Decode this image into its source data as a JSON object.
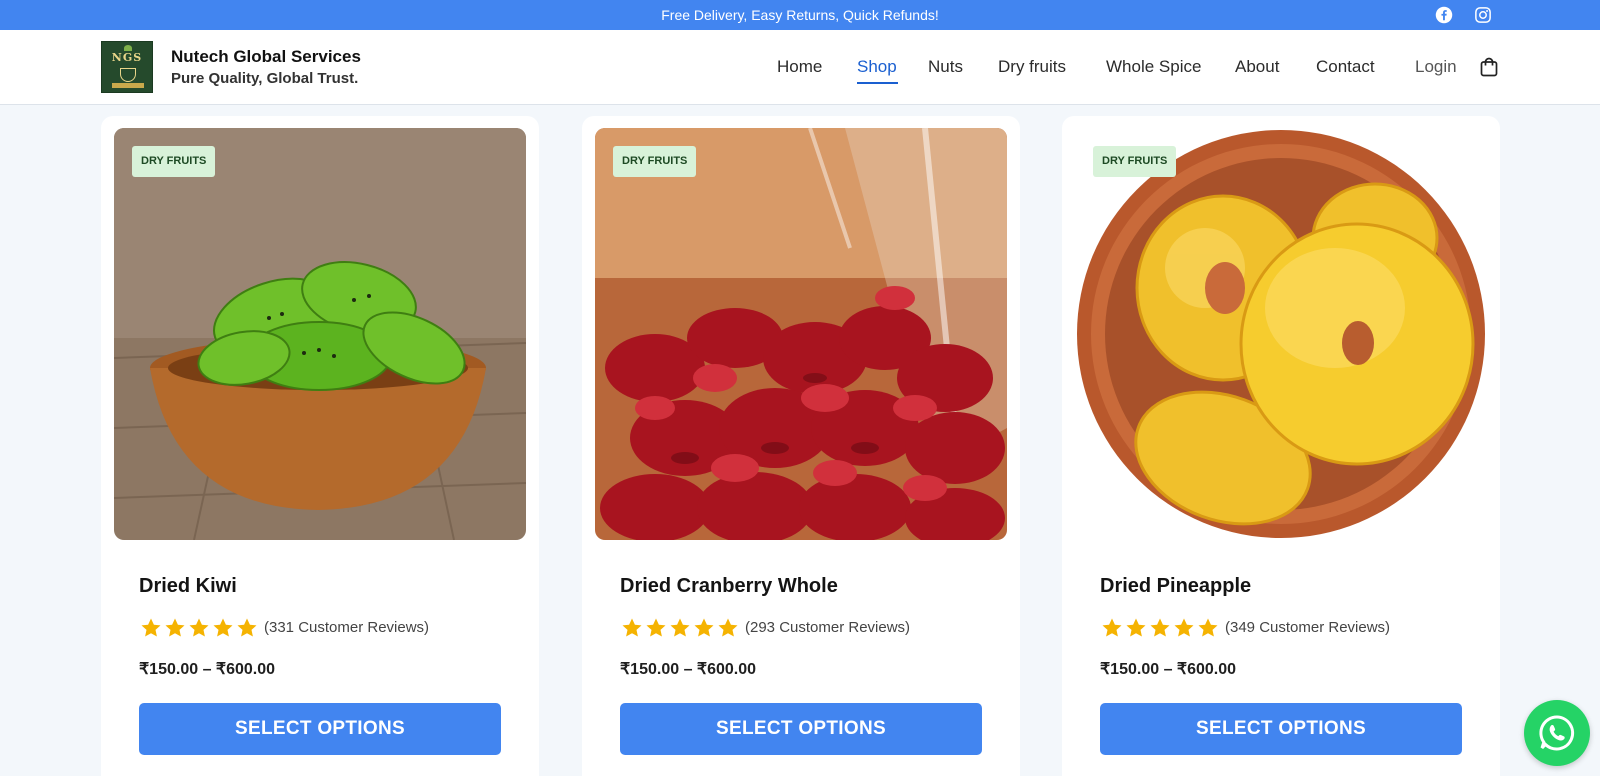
{
  "topbar": {
    "promo": "Free Delivery, Easy Returns, Quick Refunds!",
    "social": [
      "facebook-icon",
      "instagram-icon"
    ]
  },
  "header": {
    "logo_text": "NGS",
    "brand_name": "Nutech Global Services",
    "tagline": "Pure Quality, Global Trust.",
    "nav": [
      {
        "label": "Home"
      },
      {
        "label": "Shop",
        "active": true
      },
      {
        "label": "Nuts"
      },
      {
        "label": "Dry fruits"
      },
      {
        "label": "Whole Spice"
      },
      {
        "label": "About"
      },
      {
        "label": "Contact"
      }
    ],
    "login": "Login",
    "cart_icon": "shopping-bag-icon"
  },
  "products": [
    {
      "badge": "DRY FRUITS",
      "name": "Dried Kiwi",
      "rating": 5,
      "reviews": "(331 Customer Reviews)",
      "price": "₹150.00 – ₹600.00",
      "button": "SELECT OPTIONS"
    },
    {
      "badge": "DRY FRUITS",
      "name": "Dried Cranberry Whole",
      "rating": 5,
      "reviews": "(293 Customer Reviews)",
      "price": "₹150.00 – ₹600.00",
      "button": "SELECT OPTIONS"
    },
    {
      "badge": "DRY FRUITS",
      "name": "Dried Pineapple",
      "rating": 5,
      "reviews": "(349 Customer Reviews)",
      "price": "₹150.00 – ₹600.00",
      "button": "SELECT OPTIONS"
    }
  ],
  "floating": {
    "whatsapp_icon": "whatsapp-icon"
  },
  "colors": {
    "accent": "#4285f0",
    "star": "#f5b301",
    "badge_bg": "#d8f2d9",
    "nav_active": "#1a5fd0",
    "whatsapp": "#25d366"
  }
}
